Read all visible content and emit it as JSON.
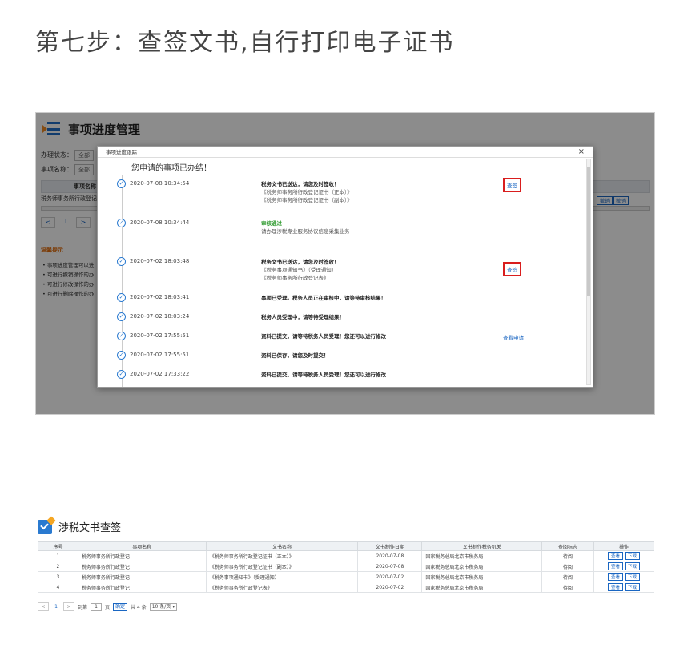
{
  "page": {
    "title": "第七步：查签文书,自行打印电子证书"
  },
  "shot1": {
    "header_title": "事项进度管理",
    "filter_status_label": "办理状态：",
    "filter_status_value": "全部",
    "filter_name_label": "事项名称：",
    "filter_name_value": "全部",
    "table_head": "事项名称",
    "row_text": "税务师事务所行政登记",
    "pager": [
      "<",
      "1",
      ">"
    ],
    "tips_title": "温馨提示",
    "tips": [
      "事项进度管理可以进",
      "可进行撤销操作的办",
      "可进行修改操作的办",
      "可进行删除操作的办"
    ],
    "right_btns": [
      "撤销",
      "撤销"
    ],
    "modal": {
      "bar_title": "事项进度跟踪",
      "close": "×",
      "heading": "您申请的事项已办结！",
      "items": [
        {
          "time": "2020-07-08 10:34:54",
          "main": "税务文书已送达，请您及时签收！",
          "sub1": "《税务师事务所行政登记证书（正本）》",
          "sub2": "《税务师事务所行政登记证书（副本）》",
          "link": "查签"
        },
        {
          "time": "2020-07-08 10:34:44",
          "main": "审核通过",
          "sub1": "请办理涉税专业服务协议信息采集业务"
        },
        {
          "time": "2020-07-02 18:03:48",
          "main": "税务文书已送达，请您及时签收！",
          "sub1": "《税务事项通知书》（受理通知）",
          "sub2": "《税务师事务所行政登记表》",
          "link": "查签"
        },
        {
          "time": "2020-07-02 18:03:41",
          "main": "事项已受理。税务人员正在审核中，请等待审核结果！"
        },
        {
          "time": "2020-07-02 18:03:24",
          "main": "税务人员受理中，请等待受理结果！"
        },
        {
          "time": "2020-07-02 17:55:51",
          "main": "资料已提交，请等待税务人员受理！您还可以进行修改",
          "link": "查看申请"
        },
        {
          "time": "2020-07-02 17:55:51",
          "main": "资料已保存，请您及时提交！"
        },
        {
          "time": "2020-07-02 17:33:22",
          "main": "资料已提交，请等待税务人员受理！您还可以进行修改"
        }
      ]
    }
  },
  "shot2": {
    "title": "涉税文书查签",
    "columns": [
      "序号",
      "事项名称",
      "文书名称",
      "文书制作日期",
      "文书制作税务机关",
      "查阅标志",
      "操作"
    ],
    "rows": [
      {
        "no": "1",
        "item": "税务师事务所行政登记",
        "doc": "《税务师事务所行政登记证书（正本）》",
        "date": "2020-07-08",
        "org": "国家税务总局北京市税务局",
        "flag": "待阅",
        "ops": [
          "查看",
          "下载"
        ]
      },
      {
        "no": "2",
        "item": "税务师事务所行政登记",
        "doc": "《税务师事务所行政登记证书（副本）》",
        "date": "2020-07-08",
        "org": "国家税务总局北京市税务局",
        "flag": "待阅",
        "ops": [
          "查看",
          "下载"
        ]
      },
      {
        "no": "3",
        "item": "税务师事务所行政登记",
        "doc": "《税务事项通知书》（受理通知）",
        "date": "2020-07-02",
        "org": "国家税务总局北京市税务局",
        "flag": "待阅",
        "ops": [
          "查看",
          "下载"
        ]
      },
      {
        "no": "4",
        "item": "税务师事务所行政登记",
        "doc": "《税务师事务所行政登记表》",
        "date": "2020-07-02",
        "org": "国家税务总局北京市税务局",
        "flag": "待阅",
        "ops": [
          "查看",
          "下载"
        ]
      }
    ],
    "pager": {
      "prev": "<",
      "page": "1",
      "next": ">",
      "goto_label": "到第",
      "goto_value": "1",
      "page_unit": "页",
      "confirm": "确定",
      "total": "共 4 条",
      "per_page": "10 条/页"
    }
  }
}
